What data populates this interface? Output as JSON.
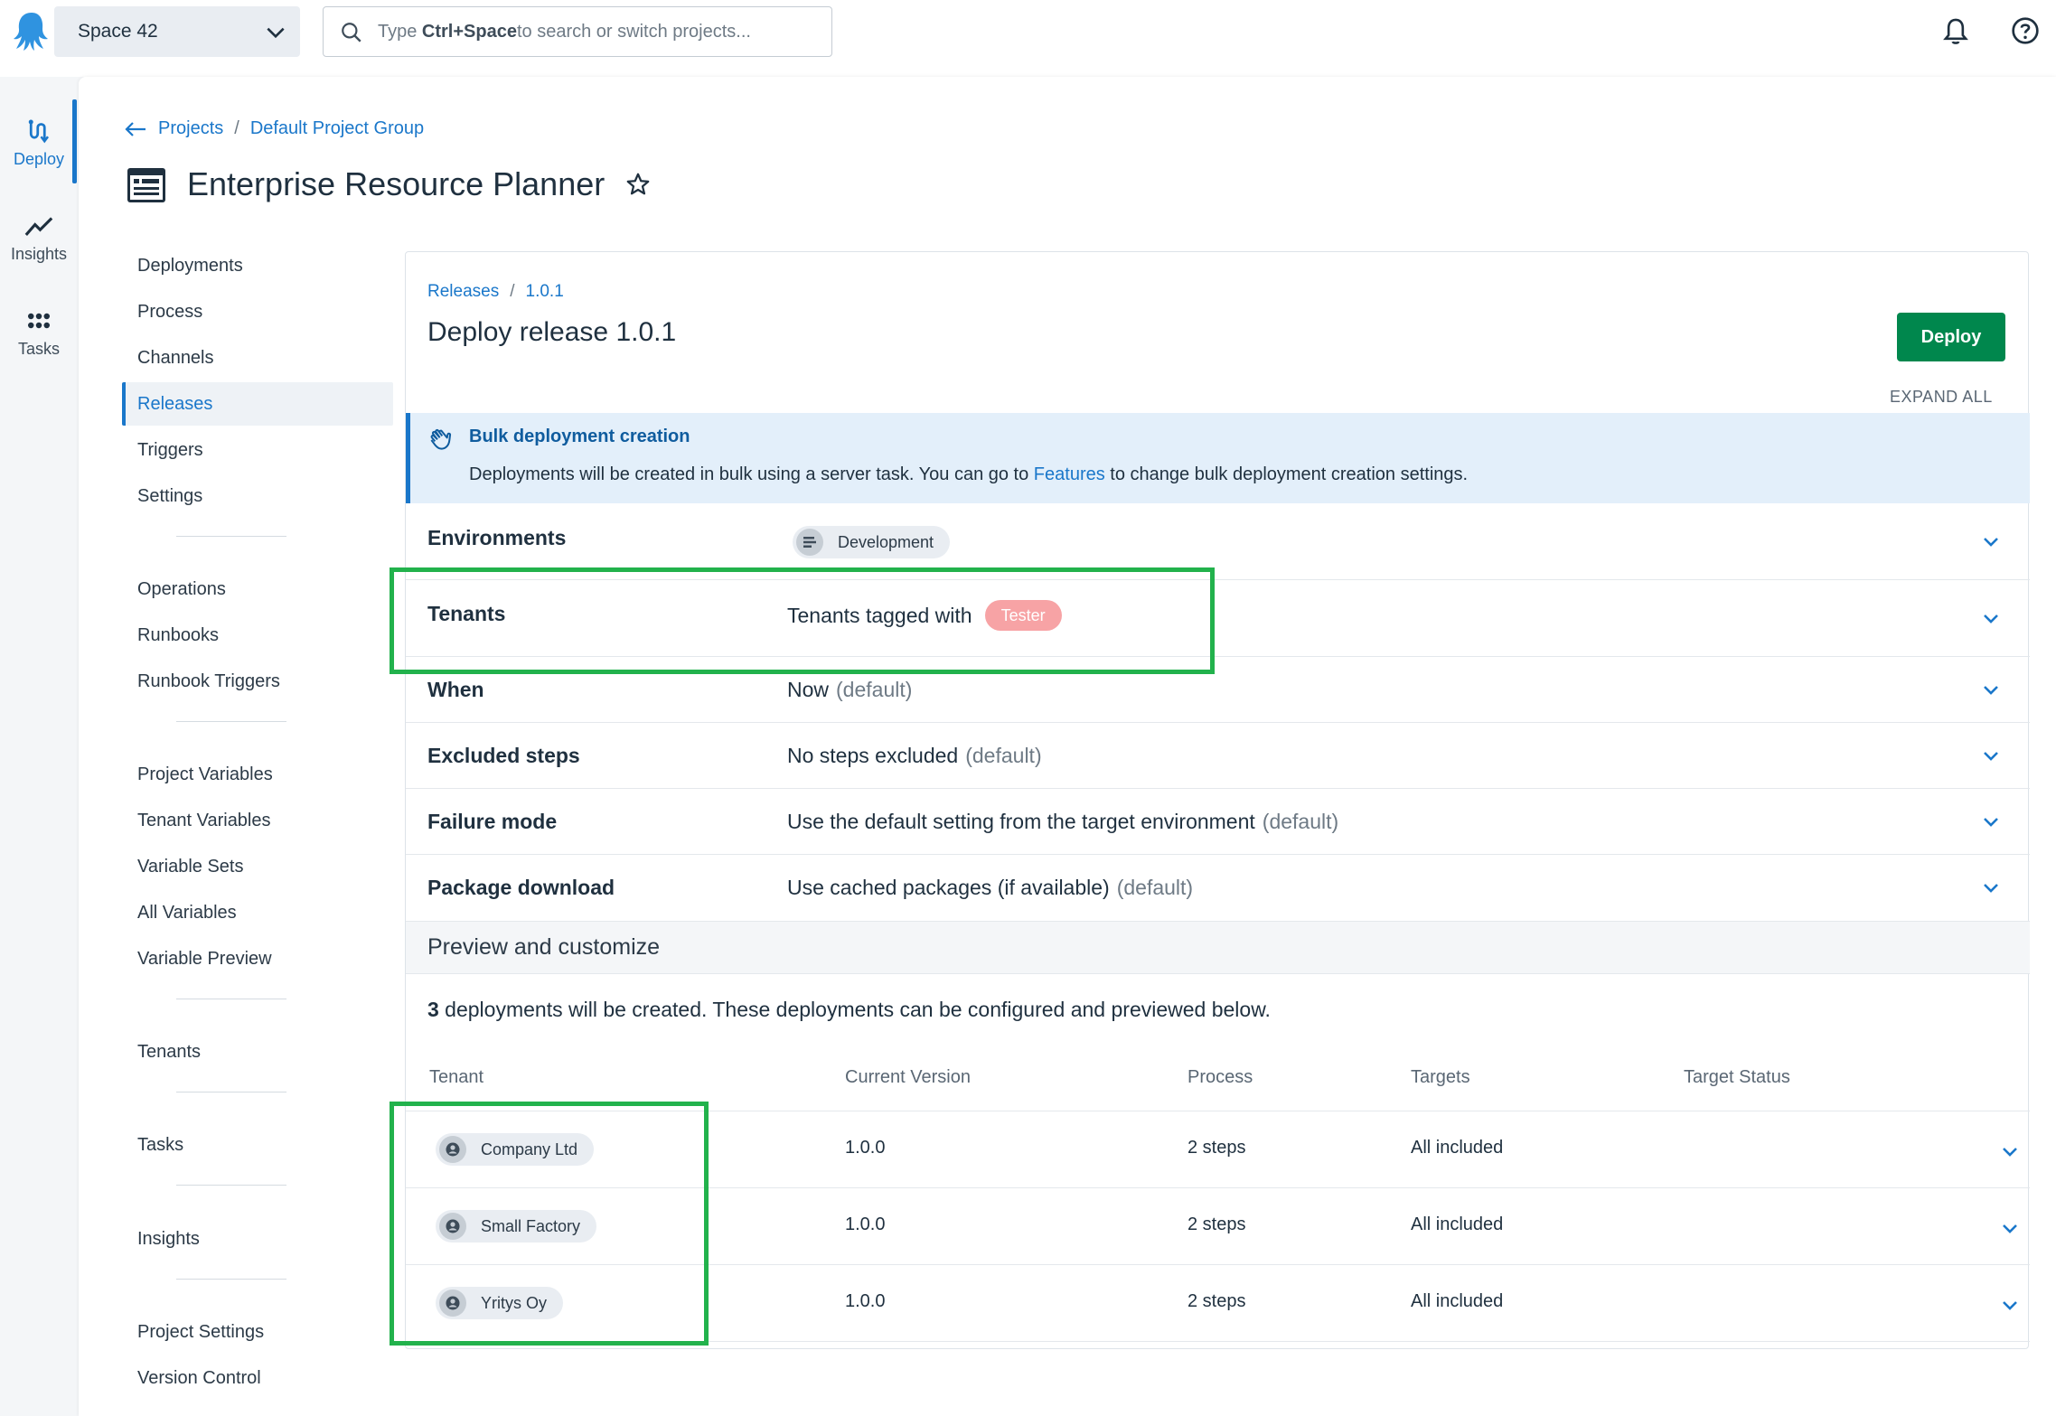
{
  "topbar": {
    "space_name": "Space 42",
    "search_prefix": "Type ",
    "search_shortcut": "Ctrl+Space",
    "search_suffix": " to search or switch projects..."
  },
  "rail": {
    "items": [
      {
        "label": "Deploy",
        "icon": "deploy-icon",
        "active": true
      },
      {
        "label": "Insights",
        "icon": "insights-icon"
      },
      {
        "label": "Tasks",
        "icon": "tasks-icon"
      }
    ]
  },
  "project": {
    "breadcrumb": [
      "Projects",
      "Default Project Group"
    ],
    "breadcrumb_sep": "/",
    "title": "Enterprise Resource Planner"
  },
  "project_nav": {
    "items": [
      {
        "label": "Deployments"
      },
      {
        "label": "Process"
      },
      {
        "label": "Channels"
      },
      {
        "label": "Releases",
        "active": true
      },
      {
        "label": "Triggers"
      },
      {
        "label": "Settings"
      },
      {
        "label": "Operations"
      },
      {
        "label": "Runbooks"
      },
      {
        "label": "Runbook Triggers"
      },
      {
        "label": "Project Variables"
      },
      {
        "label": "Tenant Variables"
      },
      {
        "label": "Variable Sets"
      },
      {
        "label": "All Variables"
      },
      {
        "label": "Variable Preview"
      },
      {
        "label": "Tenants"
      },
      {
        "label": "Tasks"
      },
      {
        "label": "Insights"
      },
      {
        "label": "Project Settings"
      },
      {
        "label": "Version Control"
      }
    ]
  },
  "release": {
    "breadcrumb": [
      "Releases",
      "1.0.1"
    ],
    "breadcrumb_sep": "/",
    "title": "Deploy release 1.0.1",
    "deploy_label": "Deploy",
    "expand_all": "EXPAND ALL",
    "banner": {
      "title": "Bulk deployment creation",
      "text_before": "Deployments will be created in bulk using a server task. You can go to ",
      "link": "Features",
      "text_after": " to change bulk deployment creation settings."
    },
    "environments": {
      "label": "Environments",
      "chip": "Development"
    },
    "tenants": {
      "label": "Tenants",
      "value": "Tenants tagged with",
      "tag": "Tester",
      "tag_color": "#f7a3a5"
    },
    "when": {
      "label": "When",
      "value": "Now",
      "default": "(default)"
    },
    "excluded": {
      "label": "Excluded steps",
      "value": "No steps excluded",
      "default": "(default)"
    },
    "failure": {
      "label": "Failure mode",
      "value": "Use the default setting from the target environment",
      "default": "(default)"
    },
    "package": {
      "label": "Package download",
      "value": "Use cached packages (if available)",
      "default": "(default)"
    },
    "preview": {
      "title": "Preview and customize",
      "count": "3",
      "summary": " deployments will be created. These deployments can be configured and previewed below."
    },
    "table": {
      "headers": [
        "Tenant",
        "Current Version",
        "Process",
        "Targets",
        "Target Status"
      ],
      "rows": [
        {
          "tenant": "Company Ltd",
          "version": "1.0.0",
          "process": "2 steps",
          "targets": "All included",
          "status": ""
        },
        {
          "tenant": "Small Factory",
          "version": "1.0.0",
          "process": "2 steps",
          "targets": "All included",
          "status": ""
        },
        {
          "tenant": "Yritys Oy",
          "version": "1.0.0",
          "process": "2 steps",
          "targets": "All included",
          "status": ""
        }
      ]
    }
  },
  "colors": {
    "accent": "#1a77ca",
    "deploy_button": "#00874d",
    "highlight": "#22b24c",
    "banner_bg": "#e3effa"
  }
}
